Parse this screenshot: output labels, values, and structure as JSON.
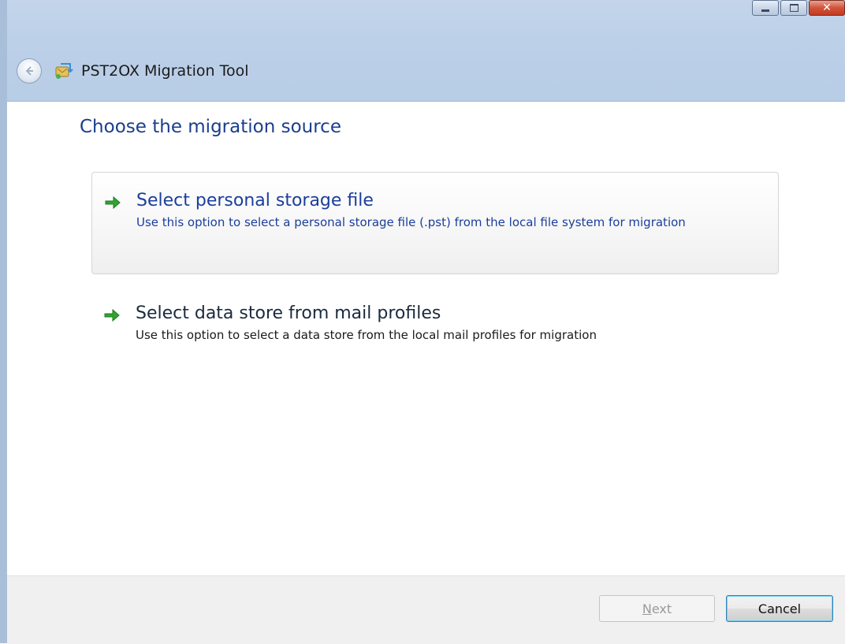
{
  "window": {
    "title": "PST2OX Migration Tool",
    "caption_buttons": {
      "minimize_icon": "minimize-icon",
      "maximize_icon": "maximize-icon",
      "close_icon": "close-icon",
      "close_glyph": "✕"
    }
  },
  "nav": {
    "back_icon": "back-arrow-icon",
    "app_icon": "migration-tool-icon"
  },
  "page": {
    "heading": "Choose the migration source"
  },
  "options": [
    {
      "title": "Select personal storage file",
      "description": "Use this option to select a personal storage file (.pst) from the local file system for migration",
      "icon": "green-arrow-icon",
      "state": "hover"
    },
    {
      "title": "Select data store from mail profiles",
      "description": "Use this option to select a data store from the local mail profiles for migration",
      "icon": "green-arrow-icon",
      "state": "normal"
    }
  ],
  "footer": {
    "next_label_mnemonic": "N",
    "next_label_rest": "ext",
    "next_enabled": false,
    "cancel_label": "Cancel"
  },
  "colors": {
    "heading": "#1a3e8c",
    "link_blue": "#1a3e9c",
    "arrow_green": "#2fa52f",
    "titlebar": "#bcd0e8",
    "footer_bg": "#f0f0f0"
  }
}
